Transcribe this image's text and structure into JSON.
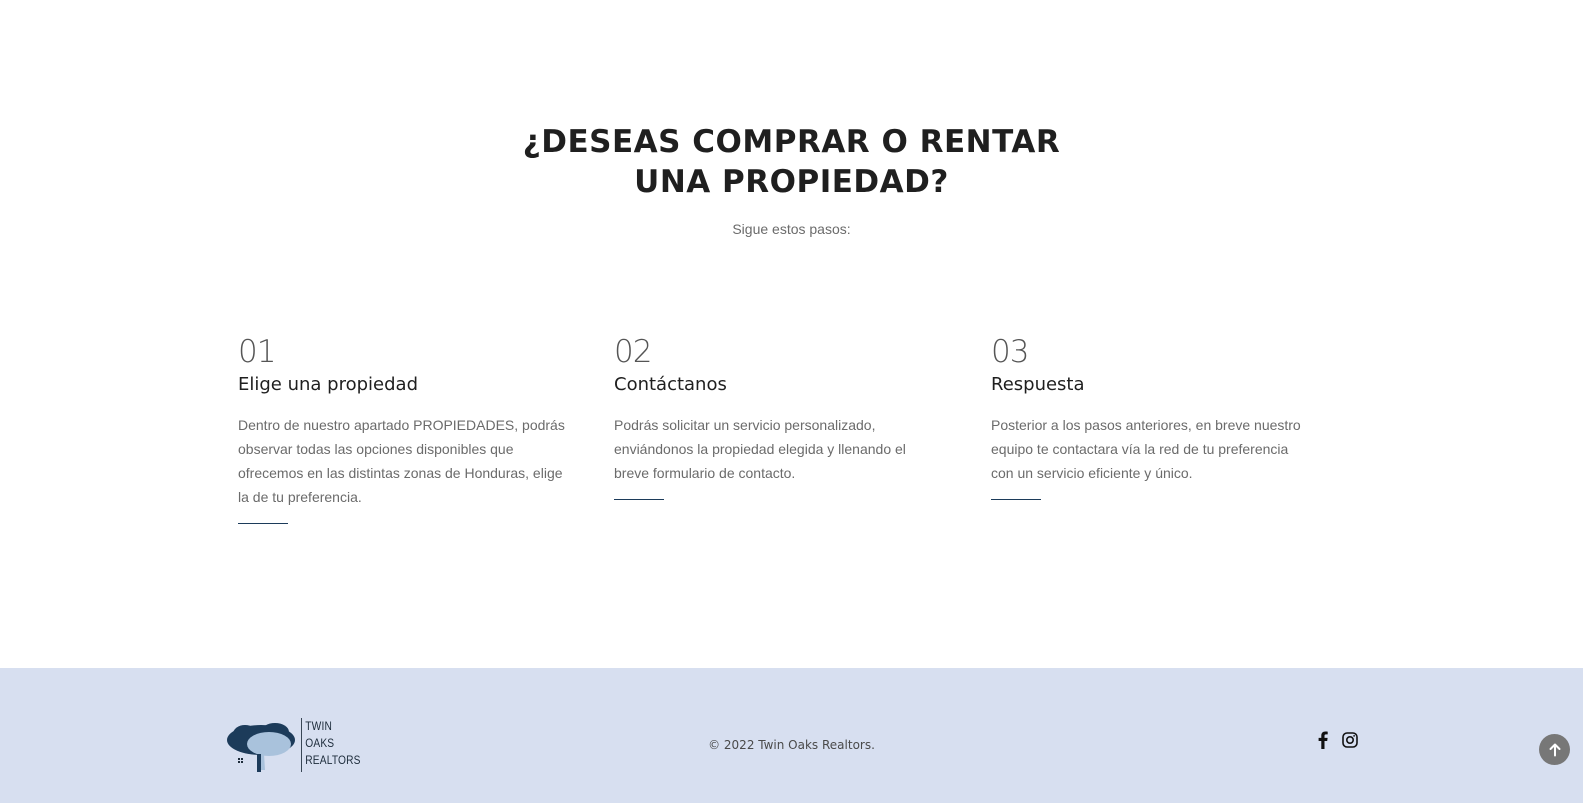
{
  "section": {
    "heading_line1": "¿DESEAS COMPRAR O RENTAR",
    "heading_line2": "UNA PROPIEDAD?",
    "subtitle": "Sigue estos pasos:"
  },
  "steps": [
    {
      "number": "01",
      "title": "Elige una propiedad",
      "text": "Dentro de nuestro apartado PROPIEDADES, podrás observar todas las opciones disponibles que ofrecemos en las distintas zonas de Honduras, elige la de tu preferencia."
    },
    {
      "number": "02",
      "title": "Contáctanos",
      "text": "Podrás solicitar un servicio personalizado, enviándonos la propiedad elegida y llenando el breve formulario de contacto."
    },
    {
      "number": "03",
      "title": "Respuesta",
      "text": "Posterior a los pasos anteriores, en breve nuestro equipo te contactara vía la red de tu preferencia con un servicio eficiente y único."
    }
  ],
  "footer": {
    "logo": {
      "line1": "TWIN",
      "line2": "OAKS",
      "line3": "REALTORS"
    },
    "copyright": "© 2022 Twin Oaks Realtors.",
    "social": [
      "facebook-icon",
      "instagram-icon"
    ]
  },
  "colors": {
    "footer_bg": "#d7dff0",
    "accent": "#1c3b5a",
    "heading": "#1f1f1f",
    "body_text": "#6b6b6b"
  }
}
